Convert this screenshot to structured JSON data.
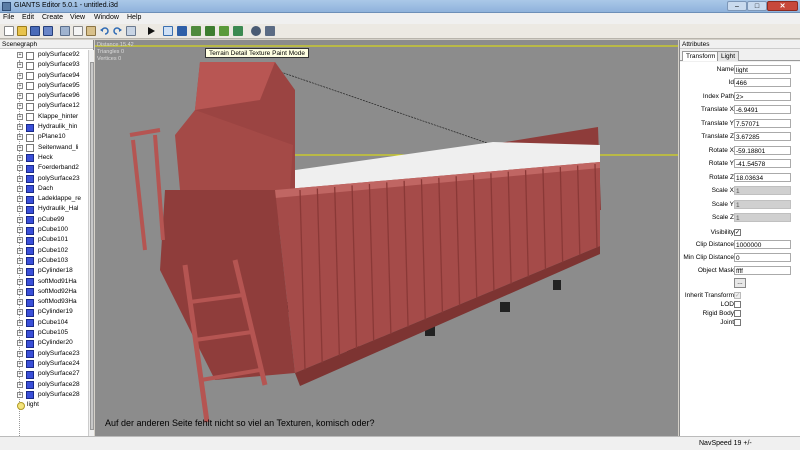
{
  "window": {
    "title": "GIANTS Editor 5.0.1 - untitled.i3d",
    "min_icon": "minimize-icon",
    "max_icon": "maximize-icon",
    "close_icon": "close-icon"
  },
  "menu": [
    "File",
    "Edit",
    "Create",
    "View",
    "Window",
    "Help"
  ],
  "toolbar": {
    "tooltip": "Terrain Detail Texture Paint Mode",
    "icons": [
      "new-icon",
      "open-icon",
      "save-icon",
      "save-as-icon",
      "cut-icon",
      "copy-icon",
      "paste-icon",
      "undo-icon",
      "redo-icon",
      "delete-icon",
      "play-icon",
      "select-mode-icon",
      "move-mode-icon",
      "terrain-sculpt-icon",
      "terrain-paint-icon",
      "terrain-detail-paint-icon",
      "foliage-paint-icon",
      "settings-icon",
      "grid-icon"
    ]
  },
  "scenegraph": {
    "title": "Scenegraph",
    "items": [
      {
        "label": "polySurface92",
        "icon": "shape"
      },
      {
        "label": "polySurface93",
        "icon": "shape"
      },
      {
        "label": "polySurface94",
        "icon": "shape"
      },
      {
        "label": "polySurface95",
        "icon": "shape"
      },
      {
        "label": "polySurface96",
        "icon": "shape"
      },
      {
        "label": "polySurface12",
        "icon": "shape"
      },
      {
        "label": "Klappe_hinter",
        "icon": "shape"
      },
      {
        "label": "Hydraulik_hin",
        "icon": "cube"
      },
      {
        "label": "pPlane10",
        "icon": "shape"
      },
      {
        "label": "Seitenwand_li",
        "icon": "shape"
      },
      {
        "label": "Heck",
        "icon": "cube"
      },
      {
        "label": "Foerderband2",
        "icon": "cube"
      },
      {
        "label": "polySurface23",
        "icon": "cube"
      },
      {
        "label": "Dach",
        "icon": "cube"
      },
      {
        "label": "Ladeklappe_re",
        "icon": "cube"
      },
      {
        "label": "Hydraulik_Hal",
        "icon": "cube"
      },
      {
        "label": "pCube99",
        "icon": "cube"
      },
      {
        "label": "pCube100",
        "icon": "cube"
      },
      {
        "label": "pCube101",
        "icon": "cube"
      },
      {
        "label": "pCube102",
        "icon": "cube"
      },
      {
        "label": "pCube103",
        "icon": "cube"
      },
      {
        "label": "pCylinder18",
        "icon": "cube"
      },
      {
        "label": "softMod91Ha",
        "icon": "cube"
      },
      {
        "label": "softMod92Ha",
        "icon": "cube"
      },
      {
        "label": "softMod93Ha",
        "icon": "cube"
      },
      {
        "label": "pCylinder19",
        "icon": "cube"
      },
      {
        "label": "pCube104",
        "icon": "cube"
      },
      {
        "label": "pCube105",
        "icon": "cube"
      },
      {
        "label": "pCylinder20",
        "icon": "cube"
      },
      {
        "label": "polySurface23",
        "icon": "cube"
      },
      {
        "label": "polySurface24",
        "icon": "cube"
      },
      {
        "label": "polySurface27",
        "icon": "cube"
      },
      {
        "label": "polySurface28",
        "icon": "cube"
      },
      {
        "label": "polySurface28",
        "icon": "cube"
      }
    ],
    "light_label": "light"
  },
  "viewport": {
    "stats": [
      "Distance  15.42",
      "Triangles  0",
      "Vertices  0"
    ],
    "caption": "Auf der anderen Seite fehlt nicht so viel an Texturen, komisch oder?",
    "model_color": "#a34a48",
    "background_color": "#8c8c8c",
    "axis_color": "#e6e600"
  },
  "attributes": {
    "title": "Attributes",
    "tabs": [
      "Transform",
      "Light"
    ],
    "fields": [
      {
        "label": "Name",
        "value": "light"
      },
      {
        "label": "Id",
        "value": "466"
      },
      {
        "label": "Index Path",
        "value": "2>"
      },
      {
        "label": "Translate X",
        "value": "-6.9491"
      },
      {
        "label": "Translate Y",
        "value": "7.57071"
      },
      {
        "label": "Translate Z",
        "value": "3.67285"
      },
      {
        "label": "Rotate X",
        "value": "-59.18801"
      },
      {
        "label": "Rotate Y",
        "value": "-41.54578"
      },
      {
        "label": "Rotate Z",
        "value": "18.03634"
      },
      {
        "label": "Scale X",
        "value": "1"
      },
      {
        "label": "Scale Y",
        "value": "1"
      },
      {
        "label": "Scale Z",
        "value": "1"
      }
    ],
    "visibility_label": "Visibility",
    "visibility_checked": true,
    "clip_label": "Clip Distance",
    "clip_value": "1000000",
    "minclip_label": "Min Clip Distance",
    "minclip_value": "0",
    "mask_label": "Object Mask",
    "mask_value": "ffff",
    "mask_button": "...",
    "inherit_label": "Inherit Transform",
    "lod_label": "LOD",
    "rigid_label": "Rigid Body",
    "joint_label": "Joint"
  },
  "status": {
    "navspeed": "NavSpeed 19 +/-"
  }
}
